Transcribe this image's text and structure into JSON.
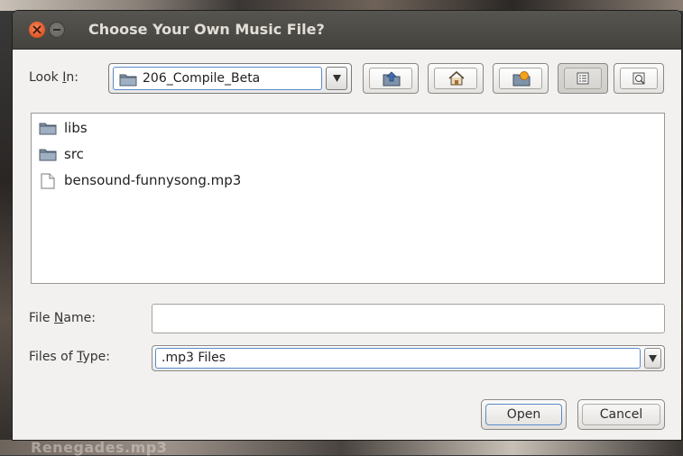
{
  "background": {
    "bottom_text": "Renegades.mp3"
  },
  "dialog": {
    "title": "Choose Your Own Music File?",
    "look_in": {
      "label_prefix": "Look ",
      "label_mnemonic": "I",
      "label_suffix": "n:",
      "selected": "206_Compile_Beta"
    },
    "toolbar": {
      "buttons": [
        "up-one-level",
        "home",
        "new-folder",
        "list-view",
        "details-view"
      ]
    },
    "files": [
      {
        "name": "libs",
        "kind": "folder"
      },
      {
        "name": "src",
        "kind": "folder"
      },
      {
        "name": "bensound-funnysong.mp3",
        "kind": "file"
      }
    ],
    "file_name": {
      "label_prefix": "File ",
      "label_mnemonic": "N",
      "label_suffix": "ame:",
      "value": ""
    },
    "file_type": {
      "label_prefix": "Files of ",
      "label_mnemonic": "T",
      "label_suffix": "ype:",
      "selected": ".mp3 Files"
    },
    "actions": {
      "open_label": "Open",
      "cancel_label": "Cancel"
    }
  },
  "colors": {
    "titlebar": "#4e4c47",
    "close_button": "#e55b2c",
    "focus_border": "#5b8ac9",
    "dialog_bg": "#f2f1f0"
  }
}
